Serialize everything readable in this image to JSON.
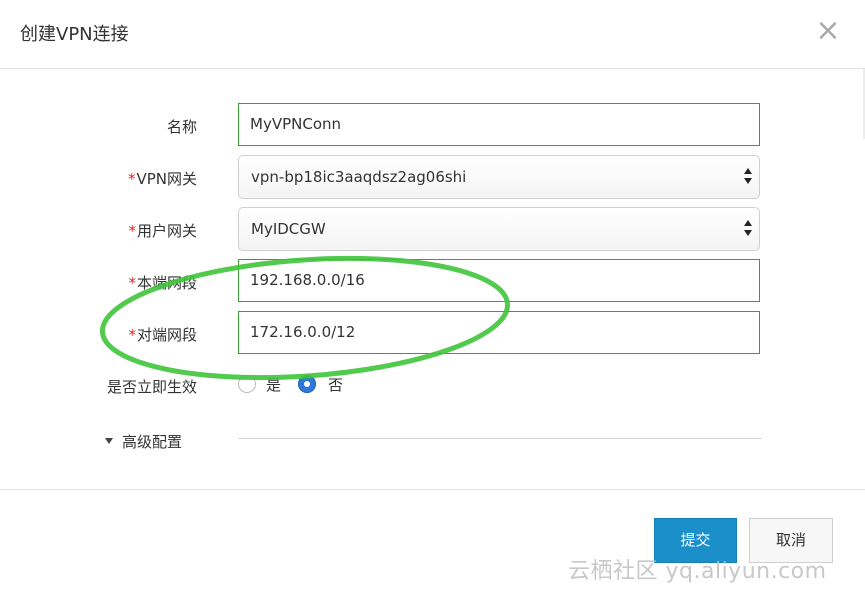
{
  "dialog": {
    "title": "创建VPN连接",
    "close_symbol": "×"
  },
  "form": {
    "name": {
      "label": "名称",
      "value": "MyVPNConn"
    },
    "vpn_gateway": {
      "required_mark": "*",
      "label": "VPN网关",
      "value": "vpn-bp18ic3aaqdsz2ag06shi"
    },
    "user_gateway": {
      "required_mark": "*",
      "label": "用户网关",
      "value": "MyIDCGW"
    },
    "local_cidr": {
      "required_mark": "*",
      "label": "本端网段",
      "value": "192.168.0.0/16"
    },
    "remote_cidr": {
      "required_mark": "*",
      "label": "对端网段",
      "value": "172.16.0.0/12"
    },
    "effective_now": {
      "label": "是否立即生效",
      "option_yes": "是",
      "option_no": "否",
      "selected": "否"
    },
    "advanced": {
      "label": "高级配置",
      "expanded": false
    }
  },
  "footer": {
    "submit_label": "提交",
    "cancel_label": "取消"
  },
  "watermark": {
    "text": "云栖社区 yq.aliyun.com"
  },
  "colors": {
    "accent_green": "#39a035",
    "highlight_ellipse": "#3ec43a",
    "primary_button": "#1b8fc9",
    "radio_selected": "#2f78d8",
    "required": "#e22222"
  }
}
